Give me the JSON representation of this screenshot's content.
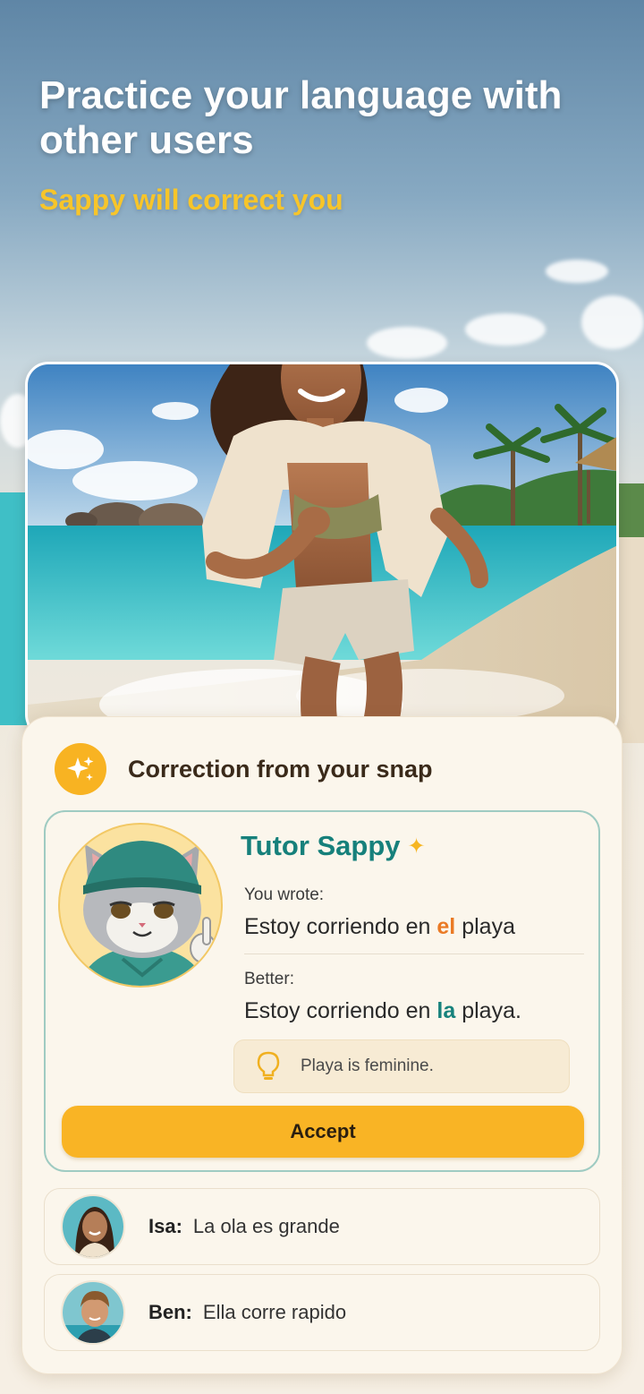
{
  "hero": {
    "headline": "Practice your language with other users",
    "subheadline": "Sappy will correct you"
  },
  "photo": {
    "subject": "beach-runner-photo"
  },
  "card": {
    "title": "Correction from your snap",
    "tutor": {
      "name": "Tutor Sappy",
      "star_glyph": "✦",
      "you_wrote_label": "You wrote:",
      "original": {
        "before": "Estoy corriendo en ",
        "highlight": "el",
        "after": " playa"
      },
      "better_label": "Better:",
      "corrected": {
        "before": "Estoy corriendo en ",
        "highlight": "la",
        "after": " playa."
      },
      "hint": "Playa is feminine.",
      "accept_label": "Accept"
    },
    "chats": [
      {
        "name": "Isa:",
        "message": "La ola es grande"
      },
      {
        "name": "Ben:",
        "message": "Ella corre rapido"
      }
    ]
  },
  "colors": {
    "accent_yellow": "#f9b425",
    "teal": "#16807b",
    "error_orange": "#ea7a25"
  }
}
